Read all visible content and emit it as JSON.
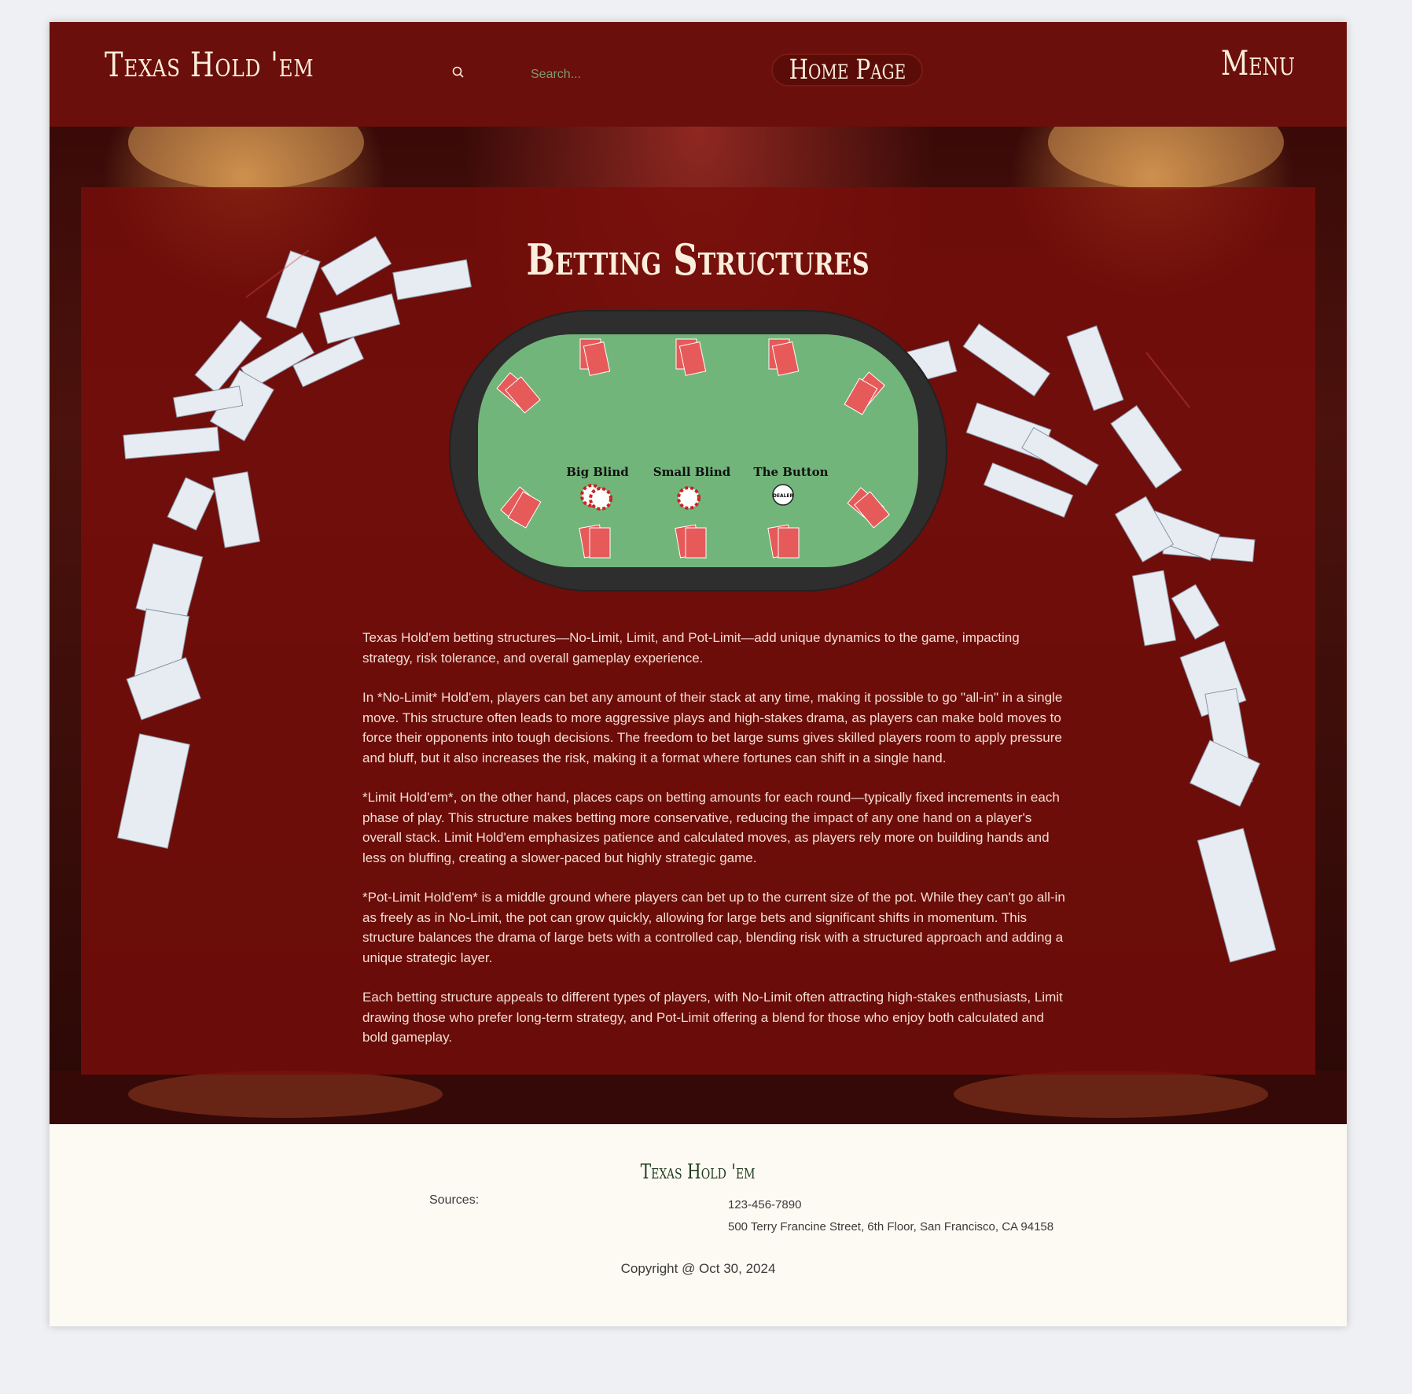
{
  "header": {
    "logo": "Texas Hold 'em",
    "search_placeholder": "Search...",
    "home_label": "Home Page",
    "menu_label": "Menu"
  },
  "main": {
    "title": "Betting Structures",
    "table": {
      "big_blind": "Big Blind",
      "small_blind": "Small Blind",
      "button": "The Button",
      "dealer_chip": "DEALER"
    },
    "paragraphs": [
      "Texas Hold'em betting structures—No-Limit, Limit, and Pot-Limit—add unique dynamics to the game, impacting strategy, risk tolerance, and overall gameplay experience.",
      "In *No-Limit* Hold'em, players can bet any amount of their stack at any time, making it possible to go \"all-in\" in a single move. This structure often leads to more aggressive plays and high-stakes drama, as players can make bold moves to force their opponents into tough decisions. The freedom to bet large sums gives skilled players room to apply pressure and bluff, but it also increases the risk, making it a format where fortunes can shift in a single hand.",
      "*Limit Hold'em*, on the other hand, places caps on betting amounts for each round—typically fixed increments in each phase of play. This structure makes betting more conservative, reducing the impact of any one hand on a player's overall stack. Limit Hold'em emphasizes patience and calculated moves, as players rely more on building hands and less on bluffing, creating a slower-paced but highly strategic game.",
      "*Pot-Limit Hold'em* is a middle ground where players can bet up to the current size of the pot. While they can't go all-in as freely as in No-Limit, the pot can grow quickly, allowing for large bets and significant shifts in momentum. This structure balances the drama of large bets with a controlled cap, blending risk with a structured approach and adding a unique strategic layer.",
      "Each betting structure appeals to different types of players, with No-Limit often attracting high-stakes enthusiasts, Limit drawing those who prefer long-term strategy, and Pot-Limit offering a blend for those who enjoy both calculated and bold gameplay."
    ]
  },
  "footer": {
    "logo": "Texas Hold 'em",
    "sources_label": "Sources:",
    "phone": "123-456-7890",
    "address": "500 Terry Francine Street, 6th Floor, San Francisco, CA 94158",
    "copyright": "Copyright @ Oct 30, 2024"
  },
  "colors": {
    "header_bg": "#6a0f0b",
    "panel_bg": "#780e0a",
    "felt": "#72b57a",
    "table_rail": "#2e2e2e",
    "footer_bg": "#fdfaf3",
    "accent_text": "#fbeedd"
  },
  "icons": {
    "search": "search-icon",
    "cards": "playing-card-icon",
    "chips": "poker-chip-icon"
  }
}
